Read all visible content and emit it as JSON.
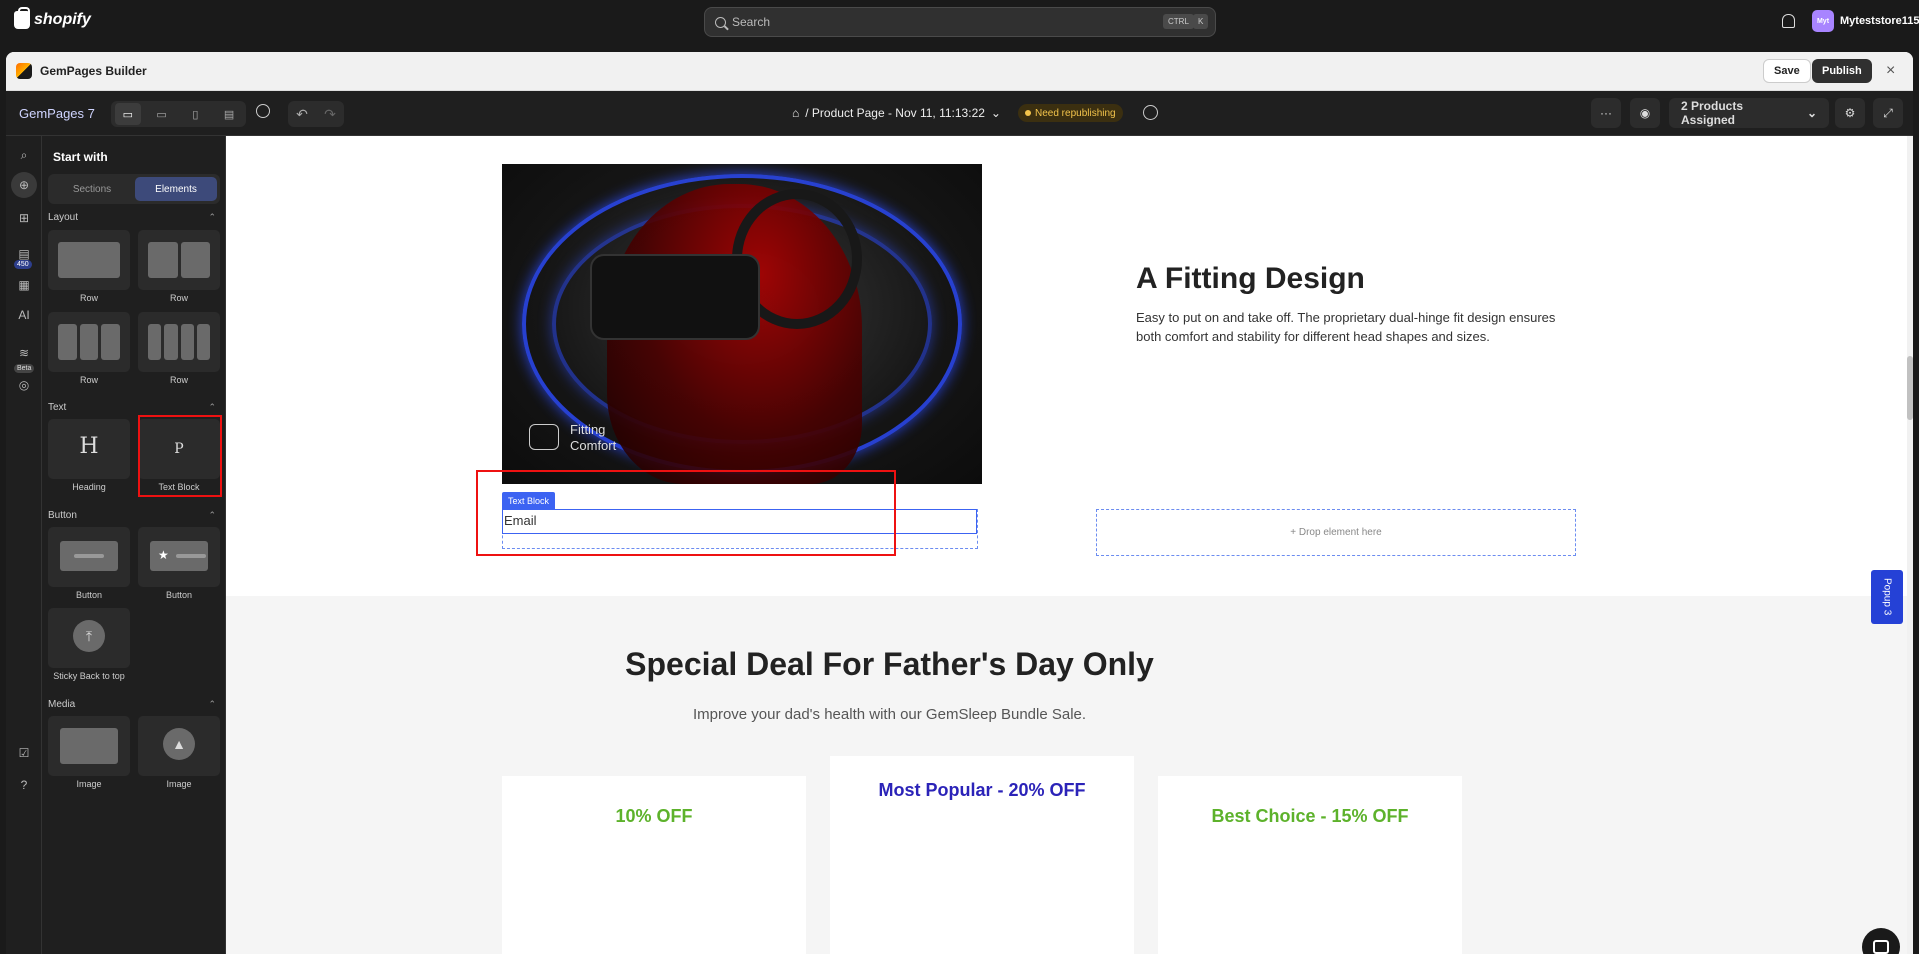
{
  "shopify": {
    "brand": "shopify",
    "search_placeholder": "Search",
    "kbd_ctrl": "CTRL",
    "kbd_k": "K",
    "store_name": "Myteststore115",
    "avatar": "Myt"
  },
  "app": {
    "title": "GemPages Builder",
    "save": "Save",
    "publish": "Publish",
    "close": "×"
  },
  "toolbar": {
    "brand": "GemPages 7",
    "page_name": "/ Product Page - Nov 11, 11:13:22",
    "status": "Need republishing",
    "more": "···",
    "assigned": "2 Products Assigned"
  },
  "rail": {
    "count_badge": "450",
    "ai_label": "AI",
    "beta": "Beta"
  },
  "panel": {
    "title": "Start with",
    "tab_sections": "Sections",
    "tab_elements": "Elements",
    "layout": "Layout",
    "text": "Text",
    "button": "Button",
    "media": "Media",
    "items": {
      "row1": "Row",
      "row2": "Row",
      "row3": "Row",
      "row4": "Row",
      "heading": "Heading",
      "text_block": "Text Block",
      "button1": "Button",
      "button2": "Button",
      "sticky": "Sticky Back to top",
      "image1": "Image",
      "image2": "Image"
    },
    "heading_glyph": "H",
    "para_glyph": "P"
  },
  "canvas": {
    "img_caption_1": "Fitting",
    "img_caption_2": "Comfort",
    "fit_title": "A Fitting Design",
    "fit_body": "Easy to put on and take off. The proprietary dual-hinge fit design ensures both comfort and stability for different head shapes and sizes.",
    "tb_tag": "Text Block",
    "tb_value": "Email",
    "drop": "+ Drop element here",
    "deal_title": "Special Deal For Father's Day Only",
    "deal_sub": "Improve your dad's health with our GemSleep Bundle Sale.",
    "card1": "10% OFF",
    "card2": "Most Popular - 20% OFF",
    "card3": "Best Choice - 15% OFF",
    "popup": "Popup 3"
  },
  "colors": {
    "accent": "#3c63f2",
    "highlight": "#e11111",
    "popular": "#2b23b8",
    "green": "#5db22b"
  }
}
